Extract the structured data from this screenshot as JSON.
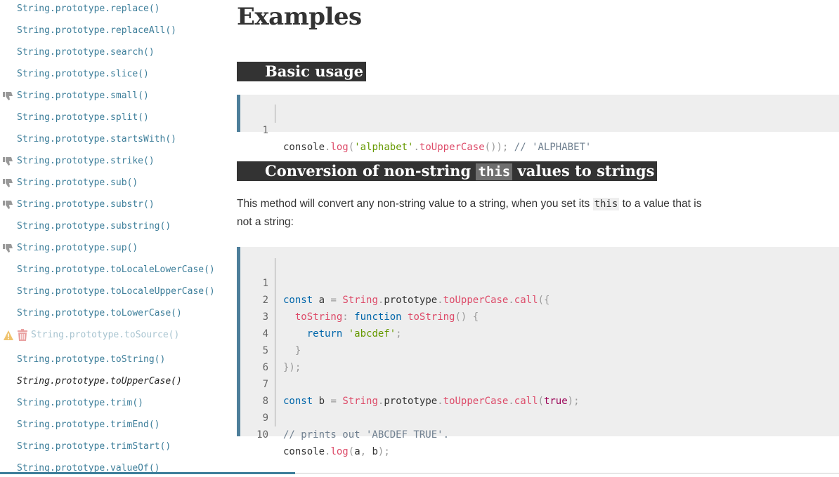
{
  "sidebar": {
    "items": [
      {
        "label": "String.prototype.replace()",
        "status": "normal"
      },
      {
        "label": "String.prototype.replaceAll()",
        "status": "normal"
      },
      {
        "label": "String.prototype.search()",
        "status": "normal"
      },
      {
        "label": "String.prototype.slice()",
        "status": "normal"
      },
      {
        "label": "String.prototype.small()",
        "status": "deprecated-thumb"
      },
      {
        "label": "String.prototype.split()",
        "status": "normal"
      },
      {
        "label": "String.prototype.startsWith()",
        "status": "normal"
      },
      {
        "label": "String.prototype.strike()",
        "status": "deprecated-thumb"
      },
      {
        "label": "String.prototype.sub()",
        "status": "deprecated-thumb"
      },
      {
        "label": "String.prototype.substr()",
        "status": "deprecated-thumb"
      },
      {
        "label": "String.prototype.substring()",
        "status": "normal"
      },
      {
        "label": "String.prototype.sup()",
        "status": "deprecated-thumb"
      },
      {
        "label": "String.prototype.toLocaleLowerCase()",
        "status": "normal"
      },
      {
        "label": "String.prototype.toLocaleUpperCase()",
        "status": "normal"
      },
      {
        "label": "String.prototype.toLowerCase()",
        "status": "normal"
      },
      {
        "label": "String.prototype.toSource()",
        "status": "obsolete"
      },
      {
        "label": "String.prototype.toString()",
        "status": "normal"
      },
      {
        "label": "String.prototype.toUpperCase()",
        "status": "current"
      },
      {
        "label": "String.prototype.trim()",
        "status": "normal"
      },
      {
        "label": "String.prototype.trimEnd()",
        "status": "normal"
      },
      {
        "label": "String.prototype.trimStart()",
        "status": "normal"
      },
      {
        "label": "String.prototype.valueOf()",
        "status": "normal"
      }
    ]
  },
  "main": {
    "heading": "Examples",
    "section1": {
      "title": "Basic usage",
      "code_line_number": "1",
      "code_parts": [
        "console",
        ".",
        "log",
        "(",
        "'alphabet'",
        ".",
        "toUpperCase",
        "());",
        " // 'ALPHABET'"
      ]
    },
    "section2": {
      "title_before": "Conversion of non-string ",
      "title_code": "this",
      "title_after": " values to strings",
      "para_before": "This method will convert any non-string value to a string, when you set its ",
      "para_code": "this",
      "para_after": " to a value that is not a string:",
      "line_numbers": [
        "1",
        "2",
        "3",
        "4",
        "5",
        "6",
        "7",
        "8",
        "9",
        "10"
      ]
    }
  },
  "colors": {
    "link": "#3d7e9a",
    "heading_bg": "#333333",
    "code_bg": "#eeeeee",
    "code_border": "#4d7e9a",
    "keyword": "#0066aa",
    "function": "#dd4a68",
    "string": "#669900"
  },
  "icons": [
    "thumbs-down-icon",
    "warning-icon",
    "trash-icon"
  ]
}
